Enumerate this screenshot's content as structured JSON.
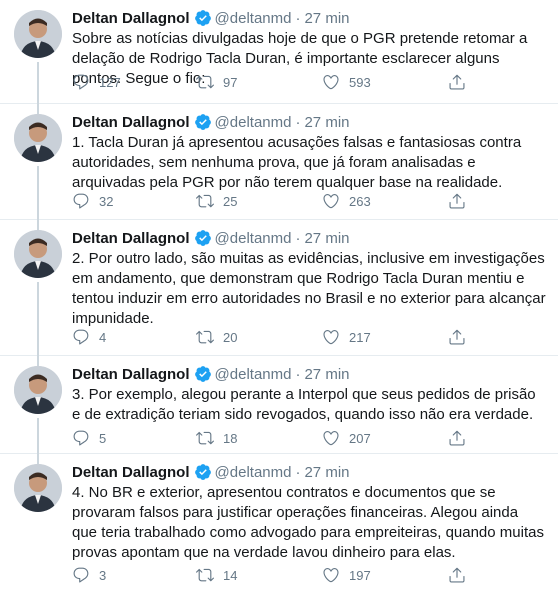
{
  "tweets": [
    {
      "author": "Deltan Dallagnol",
      "handle": "@deltanmd",
      "separator": "·",
      "time": "27 min",
      "text": "Sobre as notícias divulgadas hoje de que o PGR pretende retomar a delação de Rodrigo Tacla Duran, é importante esclarecer alguns pontos. Segue o fio:",
      "replies": "127",
      "retweets": "97",
      "likes": "593"
    },
    {
      "author": "Deltan Dallagnol",
      "handle": "@deltanmd",
      "separator": "·",
      "time": "27 min",
      "text": "1.  Tacla Duran já apresentou acusações falsas e fantasiosas contra autoridades, sem nenhuma prova, que já foram analisadas e arquivadas pela PGR por não terem qualquer base na realidade.",
      "replies": "32",
      "retweets": "25",
      "likes": "263"
    },
    {
      "author": "Deltan Dallagnol",
      "handle": "@deltanmd",
      "separator": "·",
      "time": "27 min",
      "text": "2. Por outro lado, são muitas as evidências, inclusive em investigações em andamento, que demonstram que Rodrigo Tacla Duran mentiu e tentou induzir em erro autoridades no Brasil e no exterior para alcançar impunidade.",
      "replies": "4",
      "retweets": "20",
      "likes": "217"
    },
    {
      "author": "Deltan Dallagnol",
      "handle": "@deltanmd",
      "separator": "·",
      "time": "27 min",
      "text": "3. Por exemplo, alegou perante a Interpol que seus pedidos de prisão e de extradição teriam sido revogados, quando isso não era verdade.",
      "replies": "5",
      "retweets": "18",
      "likes": "207"
    },
    {
      "author": "Deltan Dallagnol",
      "handle": "@deltanmd",
      "separator": "·",
      "time": "27 min",
      "text": "4. No BR e exterior, apresentou contratos e documentos que se provaram falsos para justificar operações financeiras. Alegou ainda que teria trabalhado como advogado para empreiteiras, quando muitas provas apontam que na verdade lavou dinheiro para elas.",
      "replies": "3",
      "retweets": "14",
      "likes": "197"
    }
  ],
  "icons": {
    "verified": "verified-badge-icon",
    "reply": "reply-icon",
    "retweet": "retweet-icon",
    "like": "heart-icon",
    "share": "share-icon"
  },
  "colors": {
    "verified": "#1da1f2",
    "secondary_text": "#657786",
    "primary_text": "#14171a",
    "divider": "#e6ecf0",
    "thread_line": "#ccd6dd"
  }
}
